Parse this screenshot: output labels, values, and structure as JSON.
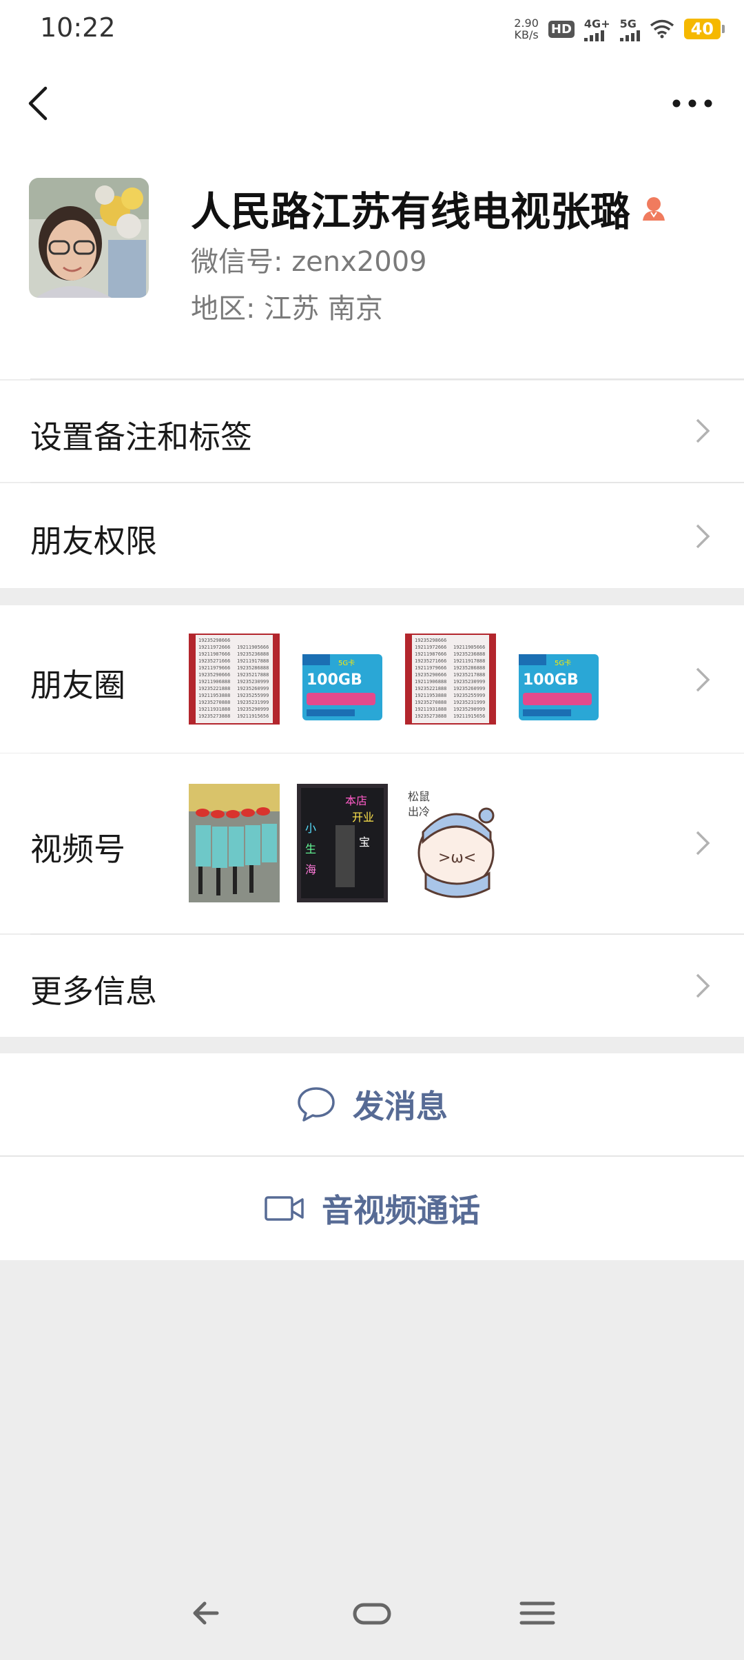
{
  "status_bar": {
    "time": "10:22",
    "net_speed_value": "2.90",
    "net_speed_unit": "KB/s",
    "hd": "HD",
    "sig1": "4G+",
    "sig2": "5G",
    "battery": "40",
    "battery_color": "#f5b800"
  },
  "nav": {
    "back_icon": "back-arrow-icon",
    "more_icon": "more-dots-icon"
  },
  "profile": {
    "name": "人民路江苏有线电视张璐",
    "gender_icon": "female-icon",
    "wechat_id": "微信号: zenx2009",
    "region": "地区: 江苏  南京"
  },
  "rows": {
    "remark": "设置备注和标签",
    "permissions": "朋友权限",
    "moments": "朋友圈",
    "channels": "视频号",
    "more_info": "更多信息"
  },
  "moments_thumbs": [
    {
      "id": "numbers",
      "text": "19235298666"
    },
    {
      "id": "sim-card",
      "text": "100GB"
    },
    {
      "id": "numbers",
      "text": "19235298666"
    },
    {
      "id": "sim-card",
      "text": "100GB"
    }
  ],
  "actions": {
    "message": "发消息",
    "call": "音视频通话"
  },
  "colors": {
    "link": "#576b95",
    "bg": "#ededed",
    "gender": "#f07b5e"
  }
}
